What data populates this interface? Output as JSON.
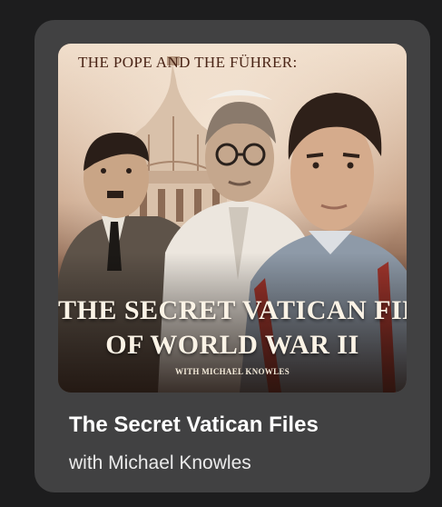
{
  "card": {
    "title": "The Secret Vatican Files",
    "subtitle": "with Michael Knowles",
    "cover": {
      "top_text": "The Pope and the Führer:",
      "title_line1": "The Secret Vatican Files",
      "title_line2": "of World War II",
      "host_text": "With Michael Knowles"
    }
  },
  "colors": {
    "page_background": "#1d1d1e",
    "card_background": "#414142",
    "title_text": "#ffffff",
    "subtitle_text": "#ebebeb"
  }
}
